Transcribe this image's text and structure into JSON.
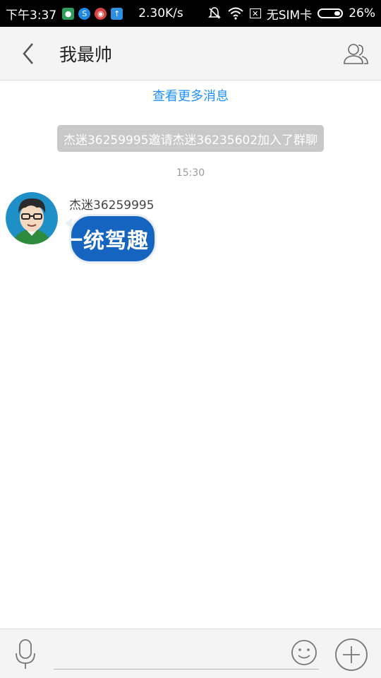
{
  "status_bar": {
    "time": "下午3:37",
    "network_speed": "2.30K/s",
    "sim_status": "无SIM卡",
    "battery": "26%",
    "icons": [
      "app-green-icon",
      "app-swirl-icon",
      "app-red-icon",
      "app-upload-icon",
      "bell-muted-icon",
      "wifi-icon",
      "no-sim-icon",
      "battery-icon"
    ]
  },
  "header": {
    "title": "我最帅",
    "back_icon": "chevron-left-icon",
    "group_icon": "group-members-icon"
  },
  "messages": {
    "load_more": "查看更多消息",
    "system_notice": "杰迷36259995邀请杰迷36235602加入了群聊",
    "timestamp": "15:30",
    "items": [
      {
        "sender": "杰迷36259995",
        "content": "一统驾趣",
        "bubble_color": "#1565c0"
      }
    ]
  },
  "input_bar": {
    "placeholder": "",
    "value": "",
    "voice_icon": "microphone-icon",
    "emoji_icon": "smiley-icon",
    "plus_icon": "plus-circle-icon"
  },
  "colors": {
    "accent": "#1e90ff",
    "notice_bg": "#c8c8c8",
    "bar_bg": "#f4f4f4"
  }
}
